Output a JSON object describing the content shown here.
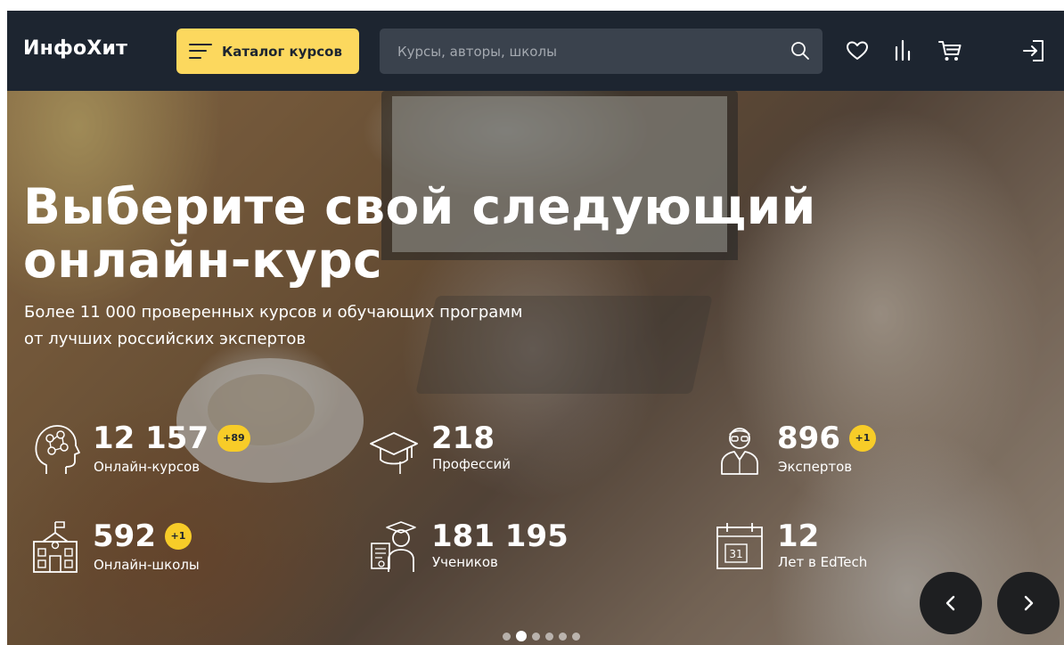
{
  "header": {
    "logo": "ИнфоХит",
    "catalog_label": "Каталог курсов",
    "search_placeholder": "Курсы, авторы, школы",
    "icons": [
      "search-icon",
      "heart-icon",
      "compare-icon",
      "cart-icon",
      "login-icon"
    ]
  },
  "hero": {
    "title": "Выберите свой следующий онлайн-курс",
    "subtitle_line1": "Более 11 000 проверенных курсов и обучающих программ",
    "subtitle_line2": "от лучших российских экспертов",
    "stats": {
      "courses": {
        "value": "12 157",
        "badge": "+89",
        "label": "Онлайн-курсов",
        "icon": "brain-head-icon"
      },
      "professions": {
        "value": "218",
        "label": "Профессий",
        "icon": "graduation-cap-icon"
      },
      "experts": {
        "value": "896",
        "badge": "+1",
        "label": "Экспертов",
        "icon": "expert-person-icon"
      },
      "schools": {
        "value": "592",
        "badge": "+1",
        "label": "Онлайн-школы",
        "icon": "school-building-icon"
      },
      "students": {
        "value": "181 195",
        "label": "Учеников",
        "icon": "student-icon"
      },
      "years": {
        "value": "12",
        "label": "Лет в EdTech",
        "icon": "calendar-icon",
        "calendar_day": "31"
      }
    },
    "carousel": {
      "slides": 6,
      "active_slide": 2
    }
  },
  "colors": {
    "header_bg": "#1d2530",
    "accent": "#fcd85e",
    "badge": "#f7cc28",
    "search_bg": "#3a424d"
  }
}
